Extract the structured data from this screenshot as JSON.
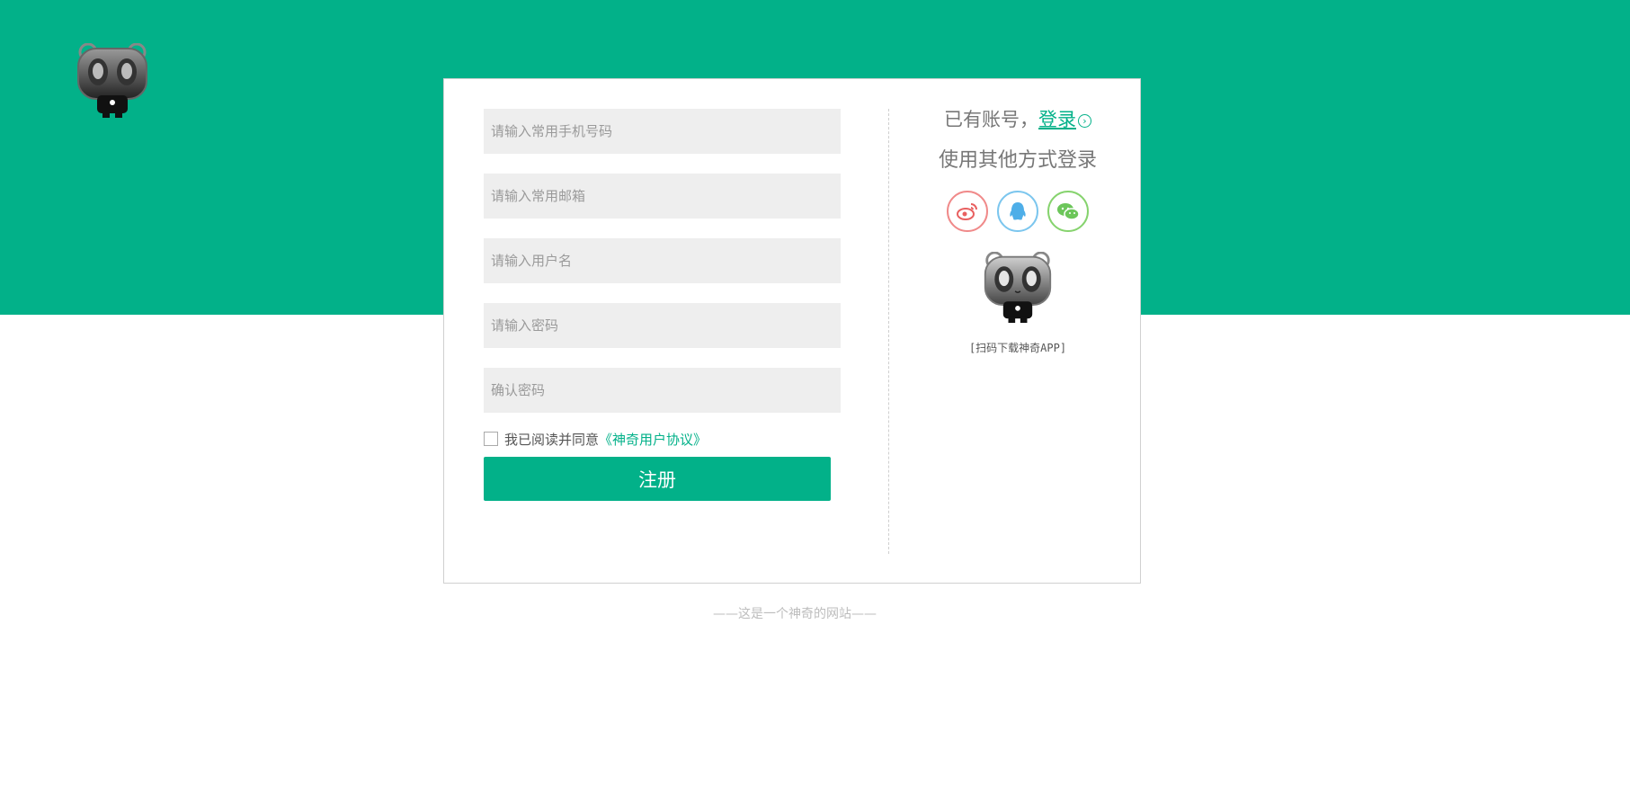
{
  "colors": {
    "brand": "#02b189",
    "field_bg": "#eeeeee"
  },
  "logo": {
    "icon": "panda-logo-icon"
  },
  "form": {
    "phone_placeholder": "请输入常用手机号码",
    "email_placeholder": "请输入常用邮箱",
    "username_placeholder": "请输入用户名",
    "password_placeholder": "请输入密码",
    "confirm_placeholder": "确认密码",
    "agree_text": "我已阅读并同意",
    "agree_link": "《神奇用户协议》",
    "agree_checked": false,
    "register_label": "注册"
  },
  "side": {
    "have_account": "已有账号，",
    "login_link": "登录",
    "other_login": "使用其他方式登录",
    "social": [
      {
        "name": "weibo",
        "icon": "weibo-icon"
      },
      {
        "name": "qq",
        "icon": "qq-icon"
      },
      {
        "name": "wechat",
        "icon": "wechat-icon"
      }
    ],
    "scan_text": "[扫码下载神奇APP]"
  },
  "footer": {
    "text": "——这是一个神奇的网站——"
  }
}
